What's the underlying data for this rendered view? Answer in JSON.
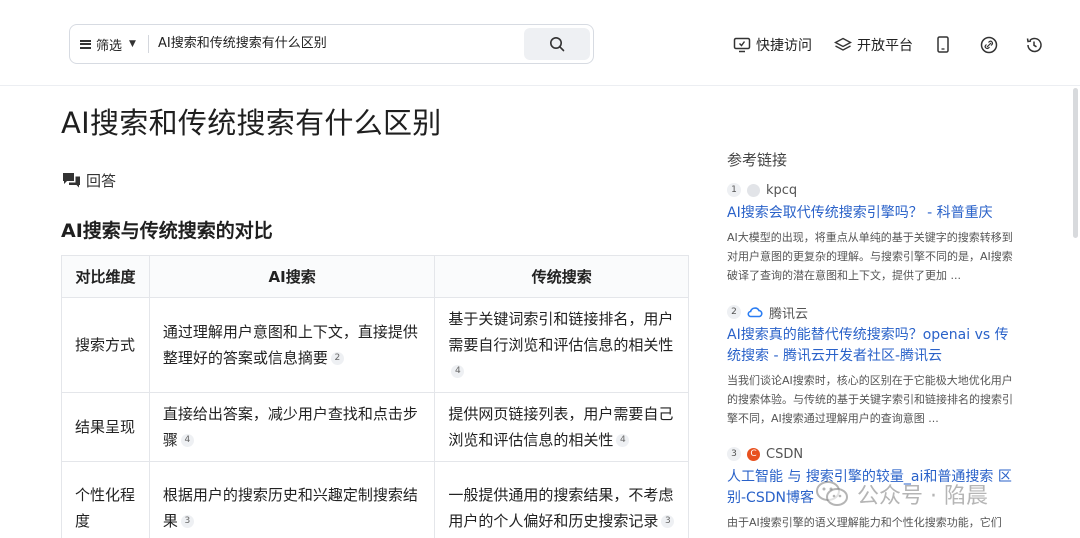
{
  "header": {
    "filter_label": "筛选",
    "query": "AI搜索和传统搜索有什么区别",
    "nav": {
      "quick_access": "快捷访问",
      "open_platform": "开放平台"
    }
  },
  "main": {
    "title": "AI搜索和传统搜索有什么区别",
    "answer_label": "回答",
    "section_heading": "AI搜索与传统搜索的对比",
    "table": {
      "headers": [
        "对比维度",
        "AI搜索",
        "传统搜索"
      ],
      "rows": [
        {
          "dim": "搜索方式",
          "ai": "通过理解用户意图和上下文，直接提供整理好的答案或信息摘要",
          "ai_ref": "2",
          "trad": "基于关键词索引和链接排名，用户需要自行浏览和评估信息的相关性",
          "trad_ref": "4"
        },
        {
          "dim": "结果呈现",
          "ai": "直接给出答案，减少用户查找和点击步骤",
          "ai_ref": "4",
          "trad": "提供网页链接列表，用户需要自己浏览和评估信息的相关性",
          "trad_ref": "4"
        },
        {
          "dim": "个性化程度",
          "ai": "根据用户的搜索历史和兴趣定制搜索结果",
          "ai_ref": "3",
          "trad": "一般提供通用的搜索结果，不考虑用户的个人偏好和历史搜索记录",
          "trad_ref": "3"
        }
      ]
    }
  },
  "side": {
    "title": "参考链接",
    "refs": [
      {
        "num": "1",
        "source": "kpcq",
        "title": "AI搜索会取代传统搜索引擎吗？ - 科普重庆",
        "snippet": "AI大模型的出现，将重点从单纯的基于关键字的搜索转移到对用户意图的更复杂的理解。与搜索引擎不同的是，AI搜索破译了查询的潜在意图和上下文，提供了更加 ..."
      },
      {
        "num": "2",
        "source": "腾讯云",
        "title": "AI搜索真的能替代传统搜索吗？openai vs 传统搜索 - 腾讯云开发者社区-腾讯云",
        "snippet": "当我们谈论AI搜索时，核心的区别在于它能极大地优化用户的搜索体验。与传统的基于关键字索引和链接排名的搜索引擎不同，AI搜索通过理解用户的查询意图 ..."
      },
      {
        "num": "3",
        "source": "CSDN",
        "title": "人工智能 与 搜索引擎的较量_ai和普通搜索 区别-CSDN博客",
        "snippet": "由于AI搜索引擎的语义理解能力和个性化搜索功能，它们"
      }
    ]
  },
  "watermark": "公众号 · 陷晨",
  "colors": {
    "link": "#2a62c9",
    "csdn": "#e8511f",
    "tencent": "#2a7df3"
  }
}
